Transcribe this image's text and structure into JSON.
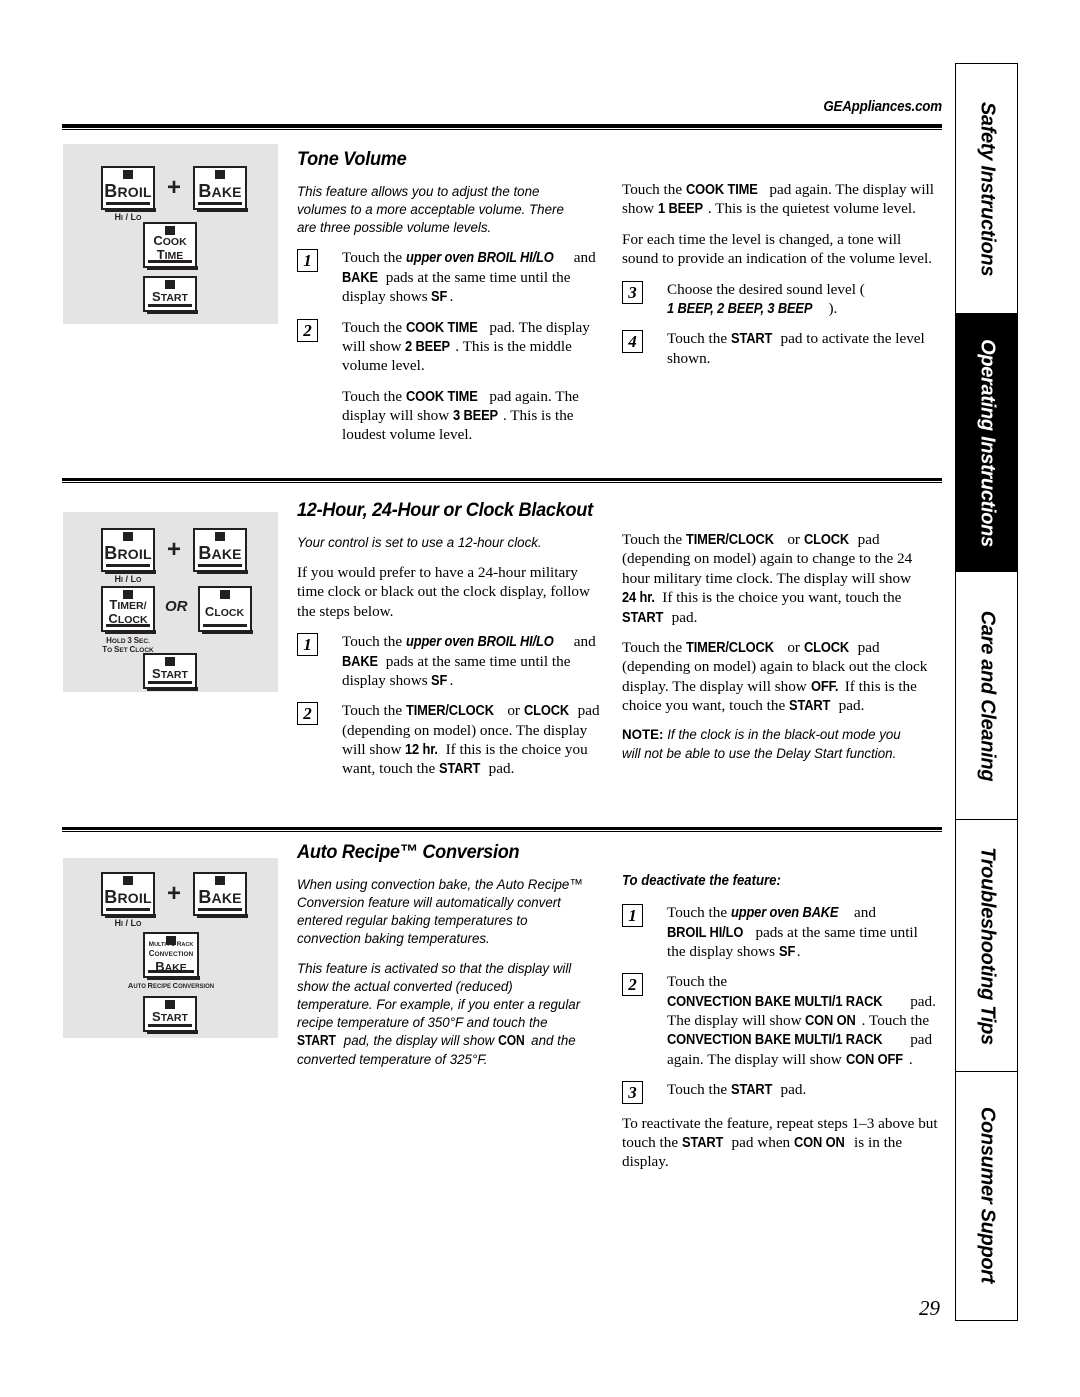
{
  "header": {
    "site": "GEAppliances.com"
  },
  "page_number": "29",
  "sidebar": {
    "tabs": [
      {
        "label": "Safety Instructions",
        "active": false
      },
      {
        "label": "Operating Instructions",
        "active": true
      },
      {
        "label": "Care and Cleaning",
        "active": false
      },
      {
        "label": "Troubleshooting Tips",
        "active": false
      },
      {
        "label": "Consumer Support",
        "active": false
      }
    ]
  },
  "keypads": {
    "tone_volume": {
      "pads": [
        "BROIL",
        "BAKE",
        "COOK TIME",
        "START"
      ],
      "operator": "+",
      "sublabels": [
        "HI / LO"
      ]
    },
    "clock": {
      "pads": [
        "BROIL",
        "BAKE",
        "TIMER/ CLOCK",
        "CLOCK",
        "START"
      ],
      "operator": "+",
      "or_label": "OR",
      "sublabels": [
        "HI / LO",
        "HOLD 3 SEC. TO SET CLOCK"
      ]
    },
    "auto_recipe": {
      "pads": [
        "BROIL",
        "BAKE",
        "MULTI / 1 RACK CONVECTION BAKE",
        "START"
      ],
      "operator": "+",
      "sublabels": [
        "HI / LO",
        "AUTO RECIPE CONVERSION"
      ]
    }
  },
  "sections": {
    "tone_volume": {
      "title": "Tone Volume",
      "intro": "This feature allows you to adjust the tone volumes to a more acceptable volume. There are three possible volume levels.",
      "steps": [
        {
          "num": "1",
          "text_pre": "Touch the ",
          "em1": "upper oven BROIL HI/LO",
          "text_mid": " and ",
          "em2": "BAKE",
          "text_mid2": " pads at the same time until the display shows ",
          "em3": "SF",
          "text_post": "."
        },
        {
          "num": "2",
          "text_pre": "Touch the ",
          "em1": "COOK TIME",
          "text_mid": " pad. The display will show ",
          "em2": "2 BEEP",
          "text_post": ". This is the middle volume level."
        },
        {
          "num": "3",
          "text_pre": "Choose the desired sound level (",
          "em1": "1 BEEP, 2 BEEP, 3 BEEP",
          "text_post": ")."
        },
        {
          "num": "4",
          "text_pre": "Touch the ",
          "em1": "START",
          "text_post": " pad to activate the level shown."
        }
      ],
      "para_2b_pre": "Touch the ",
      "para_2b_em1": "COOK TIME",
      "para_2b_mid": " pad again. The display will show ",
      "para_2b_em2": "3 BEEP",
      "para_2b_post": ". This is the loudest volume level.",
      "right_p1_pre": "Touch the ",
      "right_p1_em1": "COOK TIME",
      "right_p1_mid": " pad again. The display will show ",
      "right_p1_em2": "1 BEEP",
      "right_p1_post": ". This is the quietest volume level.",
      "right_p2": "For each time the level is changed, a tone will sound to provide an indication of the volume level."
    },
    "clock": {
      "title": "12-Hour, 24-Hour or Clock Blackout",
      "intro": "Your control is set to use a 12-hour clock.",
      "para1": "If you would prefer to have a 24-hour military time clock or black out the clock display, follow the steps below.",
      "steps": [
        {
          "num": "1",
          "text_pre": "Touch the ",
          "em1": "upper oven BROIL HI/LO",
          "text_mid": " and ",
          "em2": "BAKE",
          "text_mid2": " pads at the same time until the display shows ",
          "em3": "SF",
          "text_post": "."
        },
        {
          "num": "2",
          "text_pre": "Touch the ",
          "em1": "TIMER/CLOCK",
          "text_mid": " or ",
          "em2": "CLOCK",
          "text_mid2": " pad (depending on model) once. The display will show ",
          "em3": "12 hr.",
          "text_mid3": " If this is the choice you want, touch the ",
          "em4": "START",
          "text_post": " pad."
        }
      ],
      "right_p1_pre": "Touch the ",
      "right_p1_em1": "TIMER/CLOCK",
      "right_p1_mid": " or ",
      "right_p1_em2": "CLOCK",
      "right_p1_mid2": " pad (depending on model) again to change to the 24 hour military time clock. The display will show ",
      "right_p1_em3": "24 hr.",
      "right_p1_mid3": " If this is the choice you want, touch the ",
      "right_p1_em4": "START",
      "right_p1_post": " pad.",
      "right_p2_pre": "Touch the ",
      "right_p2_em1": "TIMER/CLOCK",
      "right_p2_mid": " or ",
      "right_p2_em2": "CLOCK",
      "right_p2_mid2": " pad (depending on model) again to black out the clock display. The display will show ",
      "right_p2_em3": "OFF.",
      "right_p2_mid3": " If this is the choice you want, touch the ",
      "right_p2_em4": "START",
      "right_p2_post": " pad.",
      "note_label": "NOTE:",
      "note_text": " If the clock is in the black-out mode you will not be able to use the Delay Start function."
    },
    "auto_recipe": {
      "title": "Auto Recipe™ Conversion",
      "intro1": "When using convection bake, the Auto Recipe™ Conversion feature will automatically convert entered regular baking temperatures to convection baking temperatures.",
      "intro2_a": "This feature is activated so that the display will show the actual converted (reduced) temperature. For example, if you enter a regular recipe temperature of 350°F and touch the ",
      "intro2_em1": "START",
      "intro2_b": " pad, the display will show ",
      "intro2_em2": "CON",
      "intro2_c": " and the converted temperature of 325°F.",
      "deactivate_heading": "To deactivate the feature:",
      "steps": [
        {
          "num": "1",
          "text_pre": "Touch the ",
          "em1": "upper oven BAKE",
          "text_mid": " and ",
          "em2": "BROIL HI/LO",
          "text_mid2": " pads at the same time until the display shows ",
          "em3": "SF",
          "text_post": "."
        },
        {
          "num": "2",
          "text_pre": "Touch the ",
          "em1": "CONVECTION BAKE MULTI/1 RACK",
          "text_mid": " pad. The display will show ",
          "em2": "CON ON",
          "text_mid2": ". Touch the ",
          "em3": "CONVECTION BAKE MULTI/1 RACK",
          "text_mid3": " pad again. The display will show ",
          "em4": "CON OFF",
          "text_post": "."
        },
        {
          "num": "3",
          "text_pre": "Touch the ",
          "em1": "START",
          "text_post": " pad."
        }
      ],
      "closing_pre": "To reactivate the feature, repeat steps 1–3 above but touch the ",
      "closing_em1": "START",
      "closing_mid": " pad when ",
      "closing_em2": "CON ON",
      "closing_post": " is in the display."
    }
  }
}
